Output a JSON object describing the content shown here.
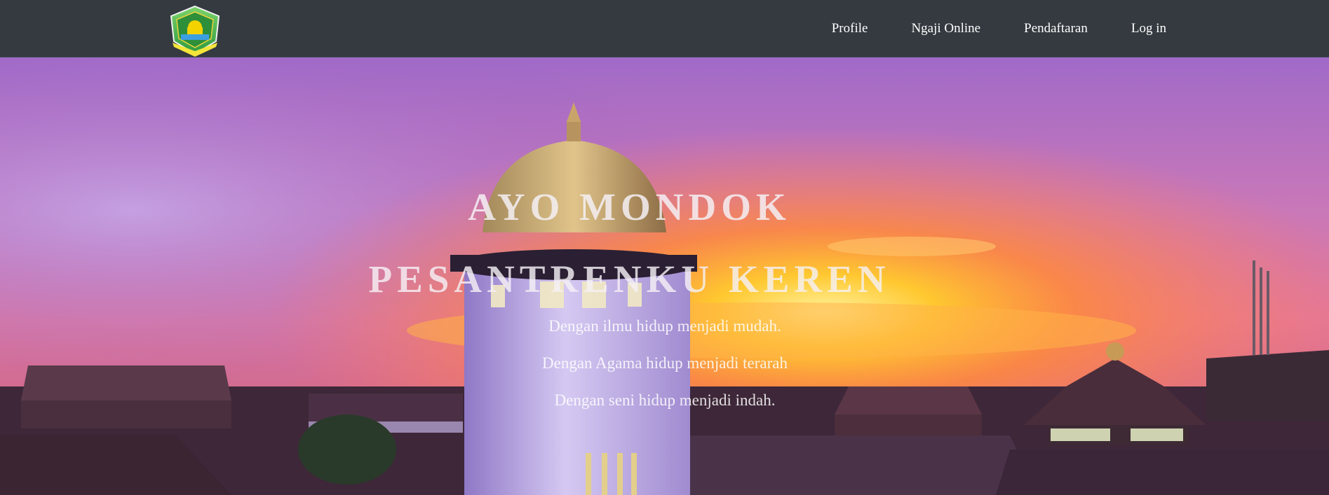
{
  "nav": {
    "items": [
      {
        "label": "Profile"
      },
      {
        "label": "Ngaji Online"
      },
      {
        "label": "Pendaftaran"
      },
      {
        "label": "Log in"
      }
    ]
  },
  "hero": {
    "title_line1": "AYO MONDOK",
    "title_line2": "PESANTRENKU KEREN",
    "taglines": [
      "Dengan ilmu hidup menjadi mudah.",
      "Dengan Agama hidup menjadi terarah",
      "Dengan seni hidup menjadi indah."
    ]
  },
  "colors": {
    "navbar": "#343a40",
    "nav_text": "#ffffff",
    "sky_top": "#8e5bb8",
    "sky_glow": "#ffb22e"
  }
}
